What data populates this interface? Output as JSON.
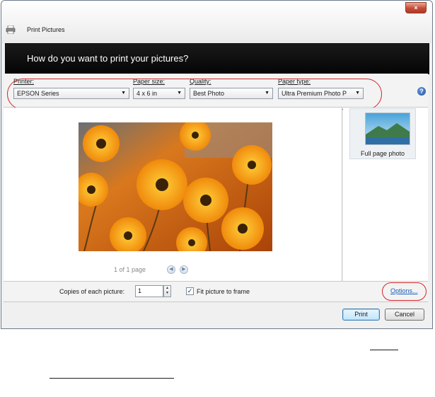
{
  "window": {
    "title": "Print Pictures",
    "close_label": "×"
  },
  "header": {
    "question": "How do you want to print your pictures?"
  },
  "settings": {
    "printer": {
      "label": "Printer:",
      "value": "EPSON Series"
    },
    "paper_size": {
      "label": "Paper size:",
      "value": "4 x 6 in"
    },
    "quality": {
      "label": "Quality:",
      "value": "Best Photo"
    },
    "paper_type": {
      "label": "Paper type:",
      "value": "Ultra Premium Photo P"
    },
    "help_label": "?"
  },
  "preview": {
    "page_count": "1 of 1 page"
  },
  "layouts": {
    "items": [
      {
        "label": "Full page photo"
      }
    ]
  },
  "options": {
    "copies_label": "Copies of each picture:",
    "copies_value": "1",
    "fit_label": "Fit picture to frame",
    "fit_checked": true,
    "options_link": "Options..."
  },
  "buttons": {
    "print": "Print",
    "cancel": "Cancel"
  },
  "colors": {
    "highlight_oval": "#d0272d",
    "banner_bg": "#0a0a0a",
    "link": "#1a5bb8"
  }
}
